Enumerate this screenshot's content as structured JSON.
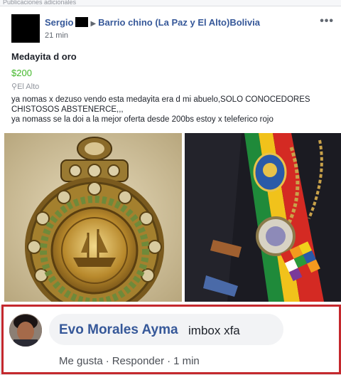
{
  "top_strip": "Publicaciones adicionales",
  "post": {
    "author": "Sergio",
    "group": "Barrio chino (La Paz y El Alto)Bolivia",
    "time": "21 min",
    "title": "Medayita d oro",
    "price": "$200",
    "location": "El Alto",
    "body_lines": [
      "ya nomas x dezuso vendo esta medayita era d mi abuelo,SOLO CONOCEDORES",
      "CHISTOSOS ABSTENERCE,,,",
      "ya nomass se la doi a la mejor oferta desde 200bs estoy x teleferico rojo"
    ],
    "more_icon": "ellipsis-icon",
    "location_icon": "map-pin-icon"
  },
  "comment": {
    "name": "Evo Morales Ayma",
    "text": "imbox xfa",
    "like_label": "Me gusta",
    "reply_label": "Responder",
    "time": "1 min"
  },
  "colors": {
    "link": "#365899",
    "price": "#42b72a",
    "highlight_border": "#c4282d"
  }
}
